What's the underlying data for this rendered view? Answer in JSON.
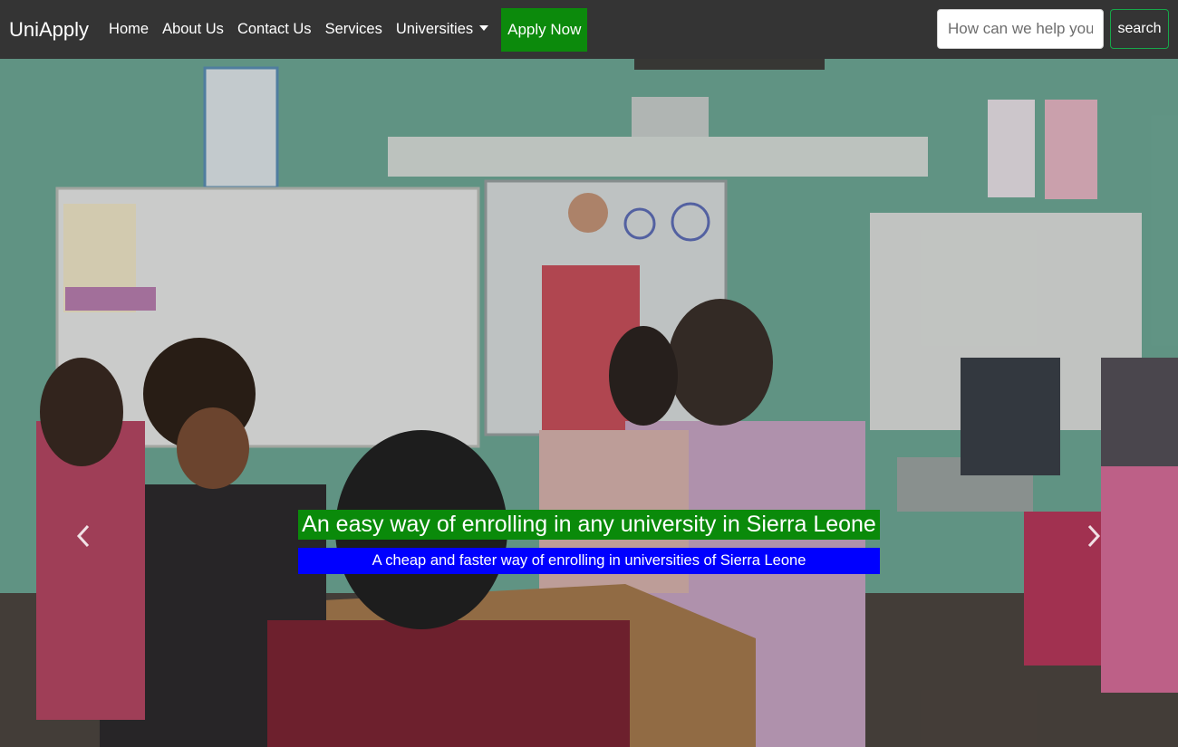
{
  "navbar": {
    "brand": "UniApply",
    "links": [
      "Home",
      "About Us",
      "Contact Us",
      "Services",
      "Universities"
    ],
    "apply_label": "Apply Now",
    "search_placeholder": "How can we help you?",
    "search_button": "search"
  },
  "hero": {
    "title": "An easy way of enrolling in any university in Sierra Leone",
    "subtitle": "A cheap and faster way of enrolling in universities of Sierra Leone"
  },
  "colors": {
    "navbar_bg": "#343434",
    "apply_bg": "#0c8a0c",
    "title_bg": "#0a8a0a",
    "subtitle_bg": "#0000ff",
    "search_border": "#17a74a"
  }
}
